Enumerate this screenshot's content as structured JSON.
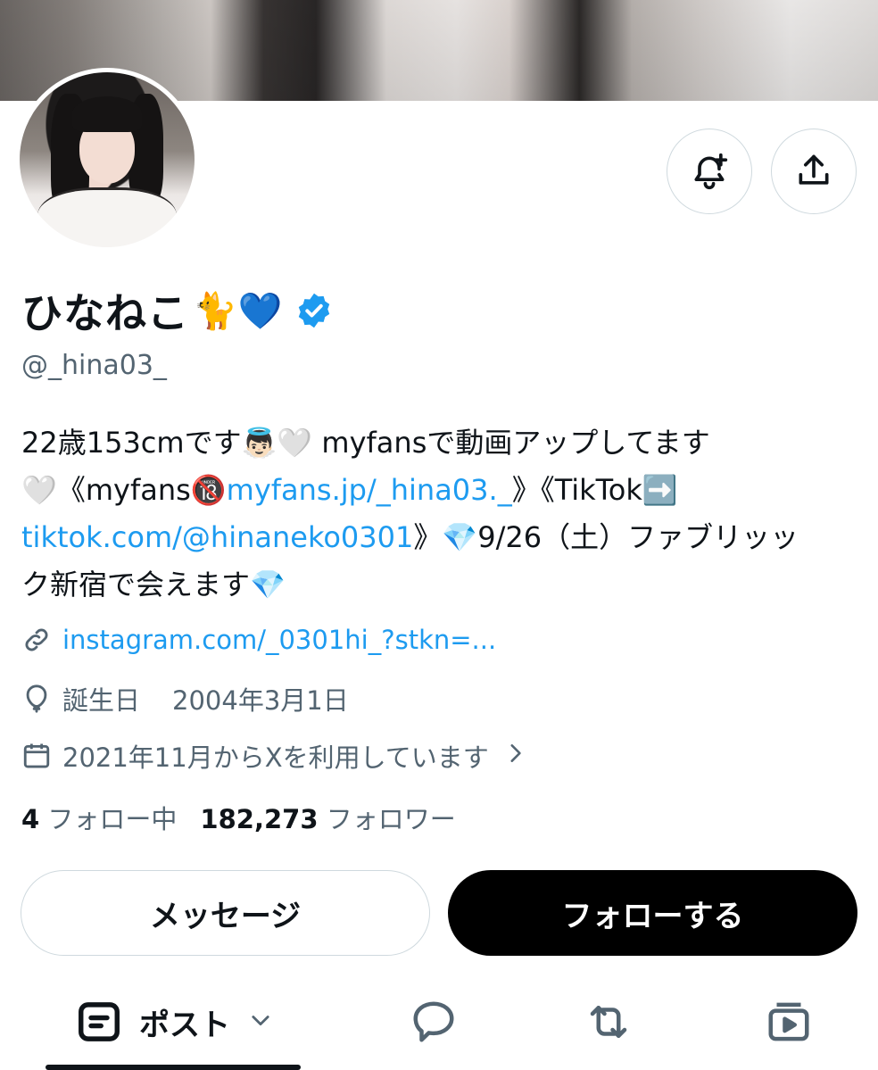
{
  "profile": {
    "display_name": "ひなねこ",
    "name_emojis": "🐈💙",
    "handle": "@_hina03_",
    "bio": {
      "line1": "22歳153cmです👼🏻🤍 myfansで動画アップしてます",
      "line2_pre": "🤍《myfans🔞",
      "line2_link": "myfans.jp/_hina03._",
      "line2_post": "》《TikTok➡️",
      "line3_link": "tiktok.com/@hinaneko0301",
      "line3_post": "》💎9/26（土）ファブリッッ",
      "line4": "ク新宿で会えます💎"
    },
    "website": "instagram.com/_0301hi_?stkn=...",
    "birthday_label": "誕生日",
    "birthday_value": "2004年3月1日",
    "joined": "2021年11月からXを利用しています",
    "following_count": "4",
    "following_label": "フォロー中",
    "followers_count": "182,273",
    "followers_label": "フォロワー"
  },
  "actions": {
    "message_label": "メッセージ",
    "follow_label": "フォローする"
  },
  "tabs": {
    "posts_label": "ポスト"
  },
  "colors": {
    "accent": "#1d9bf0",
    "text_primary": "#0f1419",
    "text_secondary": "#536471",
    "border": "#cfd9de"
  },
  "icons": [
    "notification-plus-icon",
    "share-icon",
    "verified-badge-icon",
    "link-icon",
    "balloon-icon",
    "calendar-icon",
    "chevron-right-icon",
    "posts-icon",
    "chevron-down-icon",
    "reply-icon",
    "repost-icon",
    "media-icon"
  ]
}
